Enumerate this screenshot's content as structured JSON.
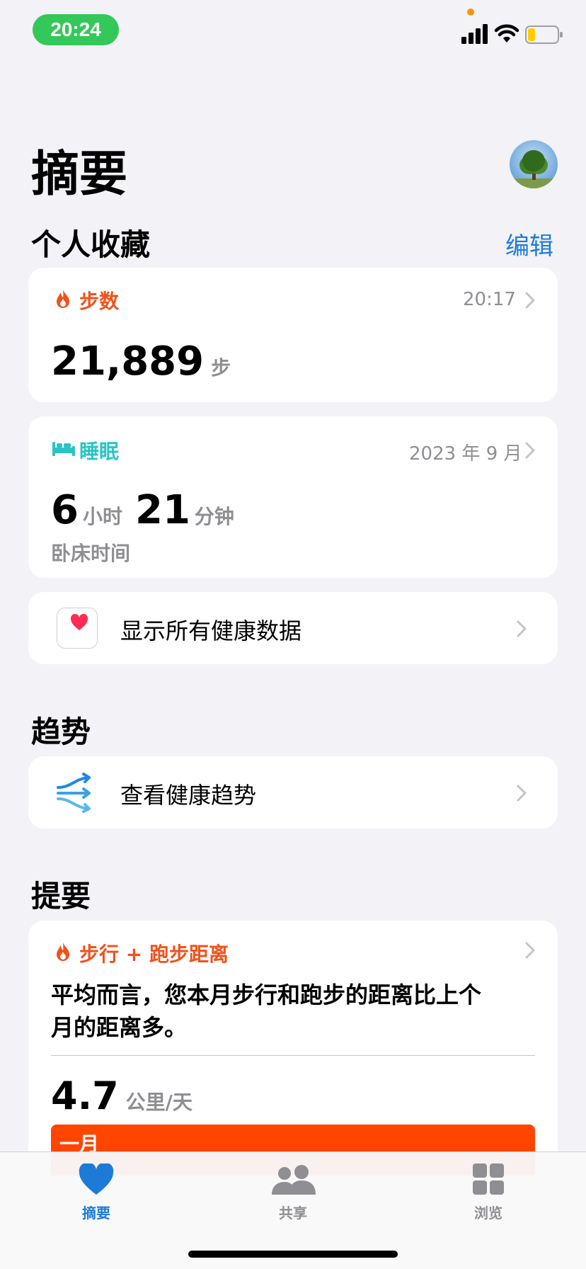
{
  "status": {
    "time": "20:24"
  },
  "header": {
    "title": "摘要"
  },
  "favorites": {
    "title": "个人收藏",
    "edit_label": "编辑",
    "steps": {
      "label": "步数",
      "time": "20:17",
      "value": "21,889",
      "unit": "步"
    },
    "sleep": {
      "label": "睡眠",
      "date": "2023 年 9 月",
      "hours": "6",
      "hours_unit": "小时",
      "minutes": "21",
      "minutes_unit": "分钟",
      "caption": "卧床时间"
    },
    "show_all": {
      "label": "显示所有健康数据"
    }
  },
  "trends": {
    "title": "趋势",
    "row_label": "查看健康趋势"
  },
  "highlights": {
    "title": "提要",
    "card": {
      "label": "步行 + 跑步距离",
      "line1": "平均而言，您本月步行和跑步的距离比上个",
      "line2": "月的距离多。",
      "value": "4.7",
      "unit": "公里/天",
      "bar_label": "一月"
    }
  },
  "tabbar": {
    "summary": "摘要",
    "sharing": "共享",
    "browse": "浏览"
  },
  "colors": {
    "accent": "#1d7bd8",
    "steps_orange": "#f0521b",
    "sleep_teal": "#2bc4c4",
    "status_green": "#34c759",
    "bar_orange": "#ff4500"
  },
  "icons": {
    "steps": "flame-icon",
    "sleep": "bed-icon",
    "show_all": "health-heart-icon",
    "trends": "trend-arrows-icon",
    "summary_tab": "heart-icon",
    "sharing_tab": "people-icon",
    "browse_tab": "grid-icon"
  }
}
